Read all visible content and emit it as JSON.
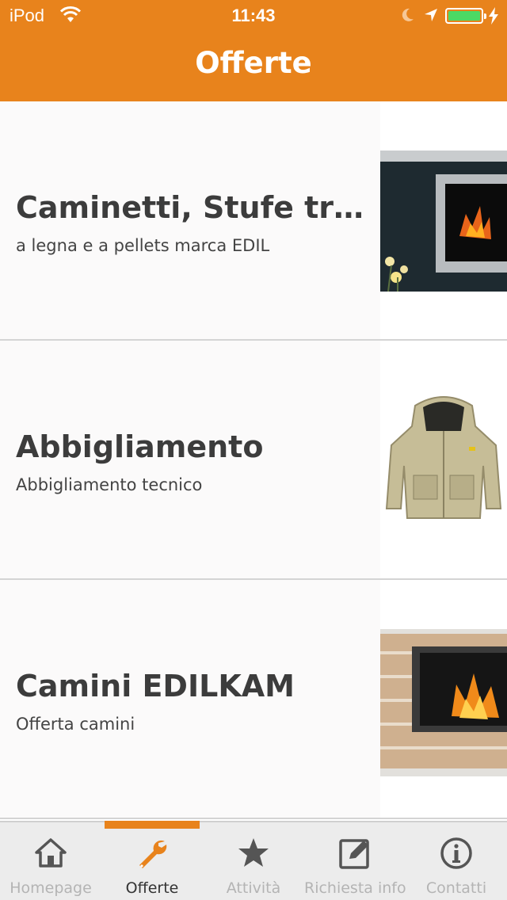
{
  "status_bar": {
    "carrier": "iPod",
    "time": "11:43"
  },
  "header": {
    "title": "Offerte"
  },
  "list": {
    "items": [
      {
        "title": "Caminetti, Stufe tra...",
        "subtitle": "a legna e a pellets marca EDIL",
        "image": "fireplace-wall-photo"
      },
      {
        "title": "Abbigliamento",
        "subtitle": "Abbigliamento tecnico",
        "image": "jacket-photo"
      },
      {
        "title": "Camini EDILKAM",
        "subtitle": "Offerta camini",
        "image": "fireplace-photo"
      }
    ]
  },
  "tabbar": {
    "active_index": 1,
    "active_color": "#e8831c",
    "tabs": [
      {
        "label": "Homepage",
        "icon": "home-icon"
      },
      {
        "label": "Offerte",
        "icon": "wrench-icon"
      },
      {
        "label": "Attività",
        "icon": "star-icon"
      },
      {
        "label": "Richiesta info",
        "icon": "edit-icon"
      },
      {
        "label": "Contatti",
        "icon": "info-icon"
      }
    ]
  },
  "colors": {
    "header": "#e8831c",
    "battery": "#4cd964"
  }
}
